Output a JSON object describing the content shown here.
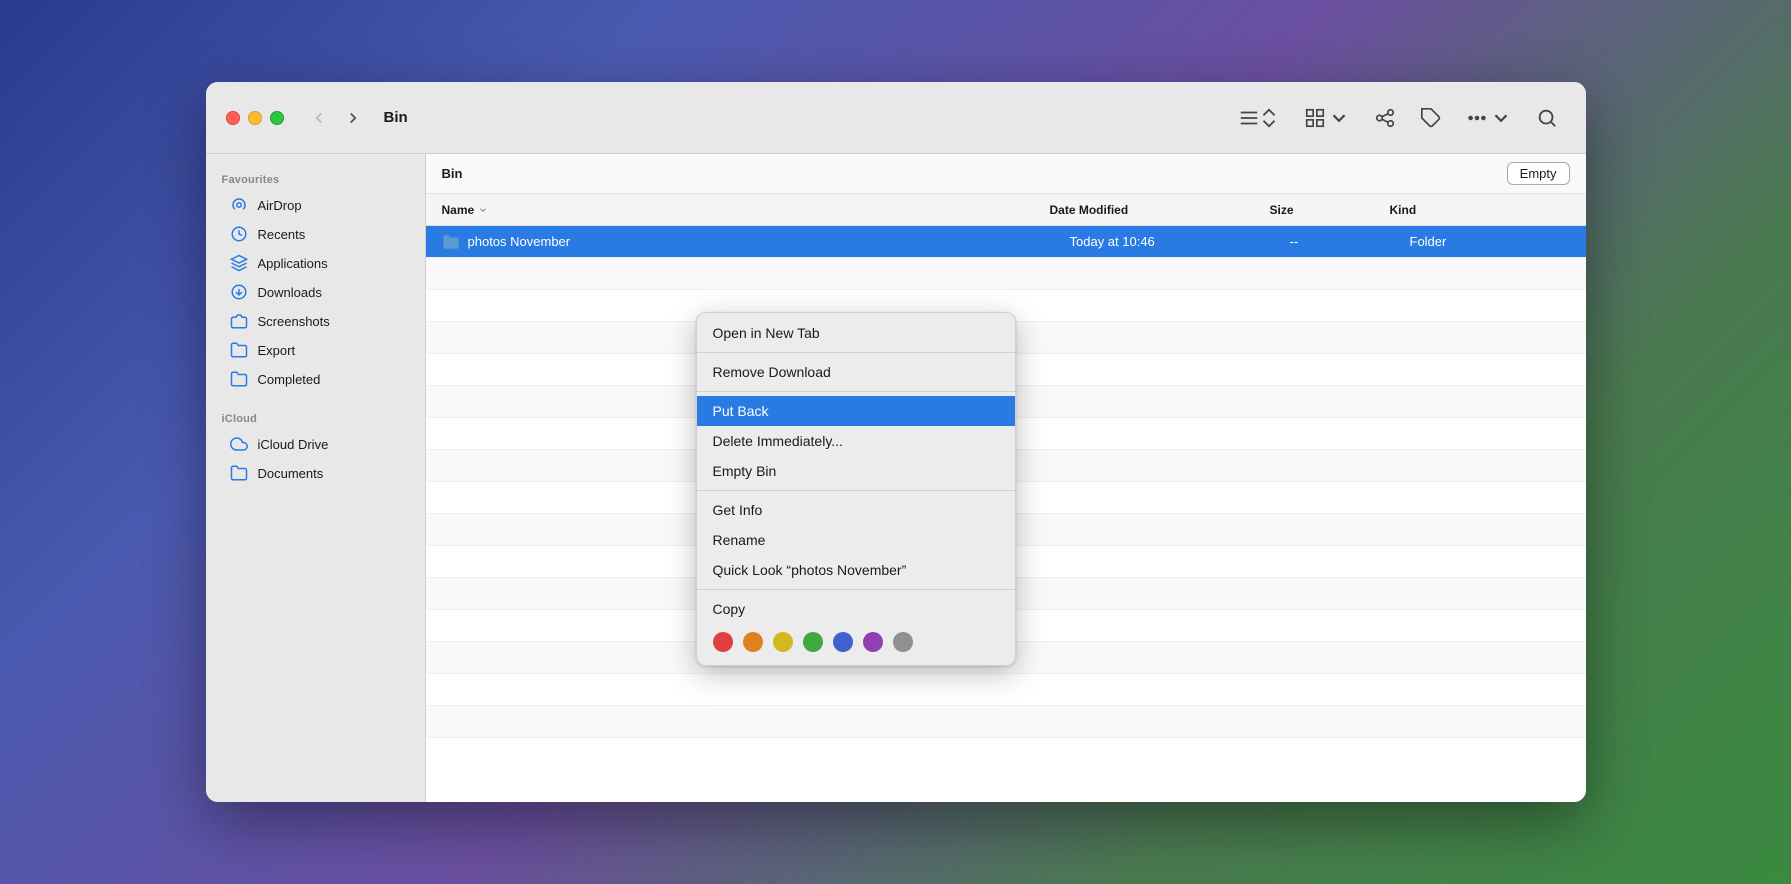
{
  "window": {
    "title": "Bin"
  },
  "traffic_lights": {
    "close": "close",
    "minimize": "minimize",
    "maximize": "maximize"
  },
  "toolbar": {
    "back_label": "‹",
    "forward_label": "›",
    "title": "Bin",
    "list_view_label": "list-view",
    "grid_view_label": "grid-view",
    "share_label": "share",
    "tag_label": "tag",
    "more_label": "more",
    "search_label": "search"
  },
  "sidebar": {
    "favourites_label": "Favourites",
    "icloud_label": "iCloud",
    "items": [
      {
        "id": "airdrop",
        "label": "AirDrop",
        "icon": "airdrop"
      },
      {
        "id": "recents",
        "label": "Recents",
        "icon": "recents"
      },
      {
        "id": "applications",
        "label": "Applications",
        "icon": "applications"
      },
      {
        "id": "downloads",
        "label": "Downloads",
        "icon": "downloads"
      },
      {
        "id": "screenshots",
        "label": "Screenshots",
        "icon": "folder"
      },
      {
        "id": "export",
        "label": "Export",
        "icon": "folder"
      },
      {
        "id": "completed",
        "label": "Completed",
        "icon": "folder"
      }
    ],
    "icloud_items": [
      {
        "id": "icloud-drive",
        "label": "iCloud Drive",
        "icon": "cloud"
      },
      {
        "id": "documents",
        "label": "Documents",
        "icon": "folder"
      }
    ]
  },
  "location_bar": {
    "path": "Bin",
    "empty_button": "Empty"
  },
  "file_list": {
    "columns": [
      {
        "id": "name",
        "label": "Name"
      },
      {
        "id": "date_modified",
        "label": "Date Modified"
      },
      {
        "id": "size",
        "label": "Size"
      },
      {
        "id": "kind",
        "label": "Kind"
      }
    ],
    "rows": [
      {
        "id": "photos-november",
        "name": "photos November",
        "date_modified": "Today at 10:46",
        "size": "--",
        "kind": "Folder",
        "selected": true
      },
      {
        "id": "row2",
        "name": "",
        "date_modified": "",
        "size": "",
        "kind": ""
      },
      {
        "id": "row3",
        "name": "",
        "date_modified": "",
        "size": "",
        "kind": ""
      },
      {
        "id": "row4",
        "name": "",
        "date_modified": "",
        "size": "",
        "kind": ""
      },
      {
        "id": "row5",
        "name": "",
        "date_modified": "",
        "size": "",
        "kind": ""
      },
      {
        "id": "row6",
        "name": "",
        "date_modified": "",
        "size": "",
        "kind": ""
      },
      {
        "id": "row7",
        "name": "",
        "date_modified": "",
        "size": "",
        "kind": ""
      },
      {
        "id": "row8",
        "name": "",
        "date_modified": "",
        "size": "",
        "kind": ""
      }
    ]
  },
  "context_menu": {
    "items": [
      {
        "id": "open-new-tab",
        "label": "Open in New Tab",
        "highlighted": false,
        "separator_after": false
      },
      {
        "id": "remove-download",
        "label": "Remove Download",
        "highlighted": false,
        "separator_after": true
      },
      {
        "id": "put-back",
        "label": "Put Back",
        "highlighted": true,
        "separator_after": false
      },
      {
        "id": "delete-immediately",
        "label": "Delete Immediately...",
        "highlighted": false,
        "separator_after": false
      },
      {
        "id": "empty-bin",
        "label": "Empty Bin",
        "highlighted": false,
        "separator_after": true
      },
      {
        "id": "get-info",
        "label": "Get Info",
        "highlighted": false,
        "separator_after": false
      },
      {
        "id": "rename",
        "label": "Rename",
        "highlighted": false,
        "separator_after": false
      },
      {
        "id": "quick-look",
        "label": "Quick Look “photos November”",
        "highlighted": false,
        "separator_after": true
      },
      {
        "id": "copy",
        "label": "Copy",
        "highlighted": false,
        "separator_after": false
      }
    ],
    "color_dots": [
      {
        "id": "red",
        "color": "#e04040"
      },
      {
        "id": "orange",
        "color": "#e08020"
      },
      {
        "id": "yellow",
        "color": "#d4b820"
      },
      {
        "id": "green",
        "color": "#40a840"
      },
      {
        "id": "blue",
        "color": "#4060d0"
      },
      {
        "id": "purple",
        "color": "#9040b0"
      },
      {
        "id": "gray",
        "color": "#909090"
      }
    ]
  }
}
